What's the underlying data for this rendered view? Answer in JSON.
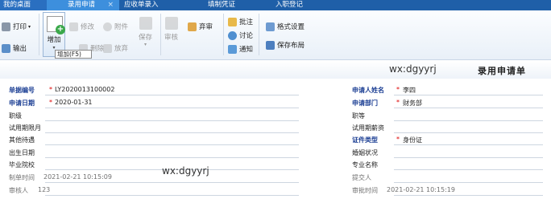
{
  "tabs": [
    {
      "label": "我的桌面"
    },
    {
      "label": "录用申请",
      "close": "×"
    },
    {
      "label": "应收单录入"
    },
    {
      "label": "填制凭证"
    },
    {
      "label": "入职登记"
    }
  ],
  "toolbar": {
    "print": "打印",
    "print_arrow": "▾",
    "export": "输出",
    "add": "增加",
    "add_arrow": "▾",
    "add_tooltip": "增加(F5)",
    "modify": "修改",
    "attachment": "附件",
    "delete": "删除",
    "abandon": "放弃",
    "save": "保存",
    "save_arrow": "▾",
    "audit": "审核",
    "discard_audit": "弃审",
    "annotate": "批注",
    "discuss": "讨论",
    "notify": "通知",
    "format_settings": "格式设置",
    "save_layout": "保存布局"
  },
  "header": {
    "watermark": "wx:dgyyrj",
    "title": "录用申请单"
  },
  "form": {
    "left": [
      {
        "label": "单据编号",
        "value": "LY2020013100002",
        "required": true
      },
      {
        "label": "申请日期",
        "value": "2020-01-31",
        "required": true
      },
      {
        "label": "职级",
        "value": ""
      },
      {
        "label": "试用期限月",
        "value": ""
      },
      {
        "label": "其他待遇",
        "value": ""
      },
      {
        "label": "出生日期",
        "value": ""
      },
      {
        "label": "毕业院校",
        "value": ""
      },
      {
        "label": "制单时间",
        "value": "2021-02-21 10:15:09"
      },
      {
        "label": "审核人",
        "value": "123"
      }
    ],
    "right": [
      {
        "label": "申请人姓名",
        "value": "李四",
        "required": true
      },
      {
        "label": "申请部门",
        "value": "财务部",
        "required": true
      },
      {
        "label": "职等",
        "value": ""
      },
      {
        "label": "试用期薪资",
        "value": ""
      },
      {
        "label": "证件类型",
        "value": "身份证",
        "required": true
      },
      {
        "label": "婚姻状况",
        "value": ""
      },
      {
        "label": "专业名称",
        "value": ""
      },
      {
        "label": "提交人",
        "value": ""
      },
      {
        "label": "审批时间",
        "value": "2021-02-21 10:15:19"
      }
    ],
    "required_mark": "*",
    "watermark": "wx:dgyyrj"
  },
  "colors": {
    "tab_bar": "#1f5fa8",
    "tab_active": "#3d8fdd",
    "required_label": "#1c3f94",
    "required_star": "#dd0000"
  }
}
